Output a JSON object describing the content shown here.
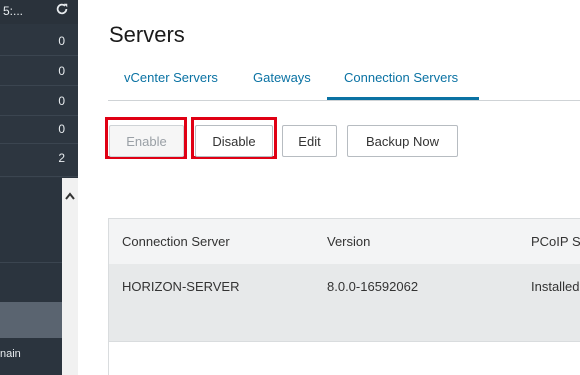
{
  "sidebar": {
    "top_text": "5:...",
    "counts": [
      "0",
      "0",
      "0",
      "0",
      "2"
    ],
    "domain_fragment": "nain"
  },
  "main": {
    "title": "Servers",
    "tabs": [
      {
        "label": "vCenter Servers"
      },
      {
        "label": "Gateways"
      },
      {
        "label": "Connection Servers",
        "active": true
      }
    ],
    "buttons": {
      "enable": "Enable",
      "disable": "Disable",
      "edit": "Edit",
      "backup": "Backup Now"
    },
    "table": {
      "columns": [
        "Connection Server",
        "Version",
        "PCoIP Se"
      ],
      "rows": [
        [
          "HORIZON-SERVER",
          "8.0.0-16592062",
          "Installed"
        ]
      ]
    }
  },
  "colors": {
    "accent": "#0a72a3",
    "highlight": "#e00014",
    "sidebar_bg": "#2d3640"
  }
}
